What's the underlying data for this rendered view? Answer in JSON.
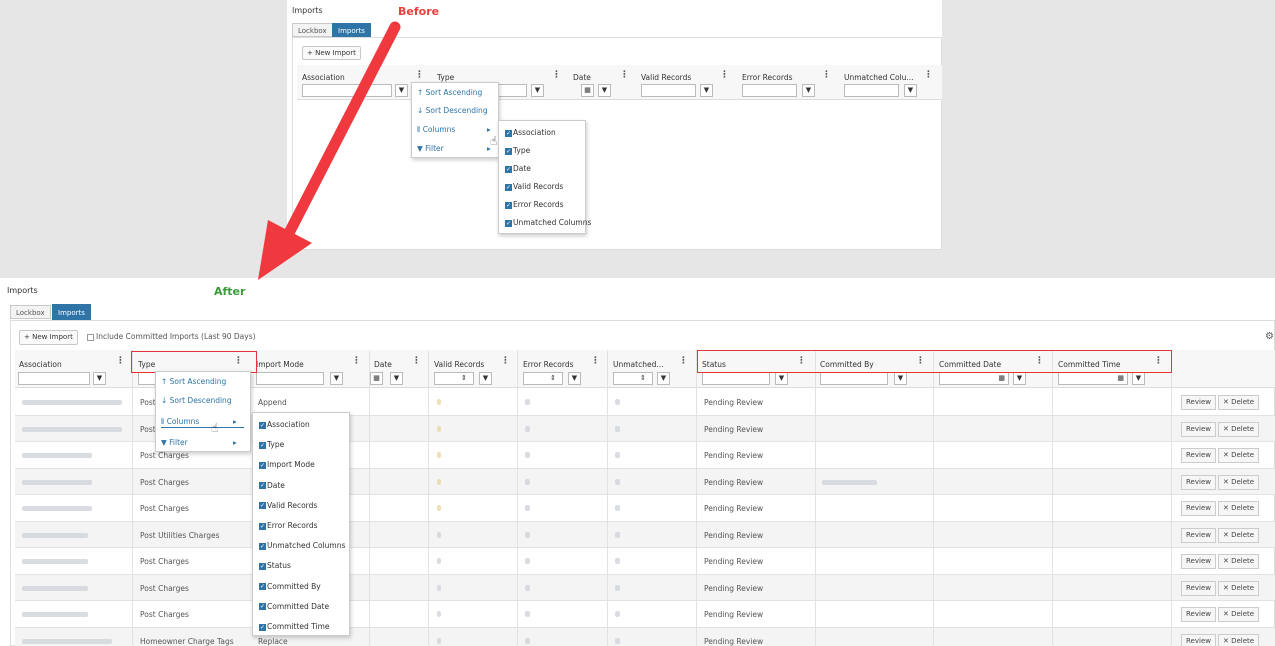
{
  "labels": {
    "before": "Before",
    "after": "After"
  },
  "colors": {
    "arrow": "#f0393f",
    "before": "#e8403f",
    "after": "#3a9a3a",
    "accent": "#2e74a6"
  },
  "before": {
    "title": "Imports",
    "tabs": [
      "Lockbox",
      "Imports"
    ],
    "new_import": "+ New Import",
    "columns": [
      "Association",
      "Type",
      "Date",
      "Valid Records",
      "Error Records",
      "Unmatched Colu..."
    ],
    "menu": {
      "sort_asc": "Sort Ascending",
      "sort_desc": "Sort Descending",
      "columns": "Columns",
      "filter": "Filter"
    },
    "column_options": [
      "Association",
      "Type",
      "Date",
      "Valid Records",
      "Error Records",
      "Unmatched Columns"
    ]
  },
  "after": {
    "title": "Imports",
    "tabs": [
      "Lockbox",
      "Imports"
    ],
    "new_import": "+ New Import",
    "include_committed": "Include Committed Imports (Last 90 Days)",
    "columns": [
      "Association",
      "Type",
      "Import Mode",
      "Date",
      "Valid Records",
      "Error Records",
      "Unmatched...",
      "Status",
      "Committed By",
      "Committed Date",
      "Committed Time"
    ],
    "menu": {
      "sort_asc": "Sort Ascending",
      "sort_desc": "Sort Descending",
      "columns": "Columns",
      "filter": "Filter"
    },
    "column_options": [
      "Association",
      "Type",
      "Import Mode",
      "Date",
      "Valid Records",
      "Error Records",
      "Unmatched Columns",
      "Status",
      "Committed By",
      "Committed Date",
      "Committed Time"
    ],
    "rows": [
      {
        "type": "Post",
        "mode": "Append",
        "status": "Pending Review"
      },
      {
        "type": "Post",
        "mode": "",
        "status": "Pending Review"
      },
      {
        "type": "Post Charges",
        "mode": "",
        "status": "Pending Review"
      },
      {
        "type": "Post Charges",
        "mode": "",
        "status": "Pending Review"
      },
      {
        "type": "Post Charges",
        "mode": "",
        "status": "Pending Review"
      },
      {
        "type": "Post Utilities Charges",
        "mode": "",
        "status": "Pending Review"
      },
      {
        "type": "Post Charges",
        "mode": "",
        "status": "Pending Review"
      },
      {
        "type": "Post Charges",
        "mode": "",
        "status": "Pending Review"
      },
      {
        "type": "Post Charges",
        "mode": "",
        "status": "Pending Review"
      },
      {
        "type": "Homeowner Charge Tags",
        "mode": "Replace",
        "status": "Pending Review"
      }
    ],
    "review": "Review",
    "delete": "✕ Delete"
  }
}
